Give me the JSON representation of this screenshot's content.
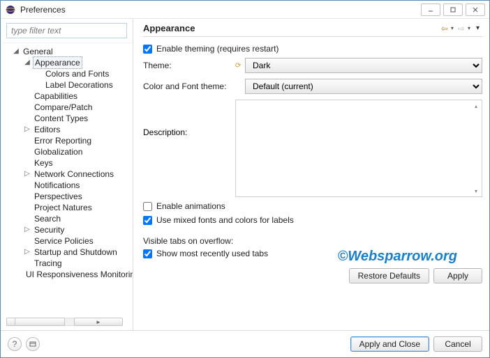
{
  "window": {
    "title": "Preferences"
  },
  "filter": {
    "placeholder": "type filter text"
  },
  "tree": {
    "root": "General",
    "selected": "Appearance",
    "appearance_children": [
      "Colors and Fonts",
      "Label Decorations"
    ],
    "items": [
      {
        "label": "Capabilities",
        "exp": false
      },
      {
        "label": "Compare/Patch",
        "exp": false
      },
      {
        "label": "Content Types",
        "exp": false
      },
      {
        "label": "Editors",
        "exp": true
      },
      {
        "label": "Error Reporting",
        "exp": false
      },
      {
        "label": "Globalization",
        "exp": false
      },
      {
        "label": "Keys",
        "exp": false
      },
      {
        "label": "Network Connections",
        "exp": true
      },
      {
        "label": "Notifications",
        "exp": false
      },
      {
        "label": "Perspectives",
        "exp": false
      },
      {
        "label": "Project Natures",
        "exp": false
      },
      {
        "label": "Search",
        "exp": false
      },
      {
        "label": "Security",
        "exp": true
      },
      {
        "label": "Service Policies",
        "exp": false
      },
      {
        "label": "Startup and Shutdown",
        "exp": true
      },
      {
        "label": "Tracing",
        "exp": false
      },
      {
        "label": "UI Responsiveness Monitoring",
        "exp": false
      }
    ]
  },
  "page": {
    "heading": "Appearance",
    "enable_theming_label": "Enable theming (requires restart)",
    "enable_theming_checked": true,
    "theme_label": "Theme:",
    "theme_value": "Dark",
    "cft_label": "Color and Font theme:",
    "cft_value": "Default (current)",
    "description_label": "Description:",
    "enable_animations_label": "Enable animations",
    "enable_animations_checked": false,
    "mixed_fonts_label": "Use mixed fonts and colors for labels",
    "mixed_fonts_checked": true,
    "visible_tabs_heading": "Visible tabs on overflow:",
    "show_recent_label": "Show most recently used tabs",
    "show_recent_checked": true
  },
  "buttons": {
    "restore_defaults": "Restore Defaults",
    "apply": "Apply",
    "apply_close": "Apply and Close",
    "cancel": "Cancel"
  },
  "watermark": "©Websparrow.org"
}
